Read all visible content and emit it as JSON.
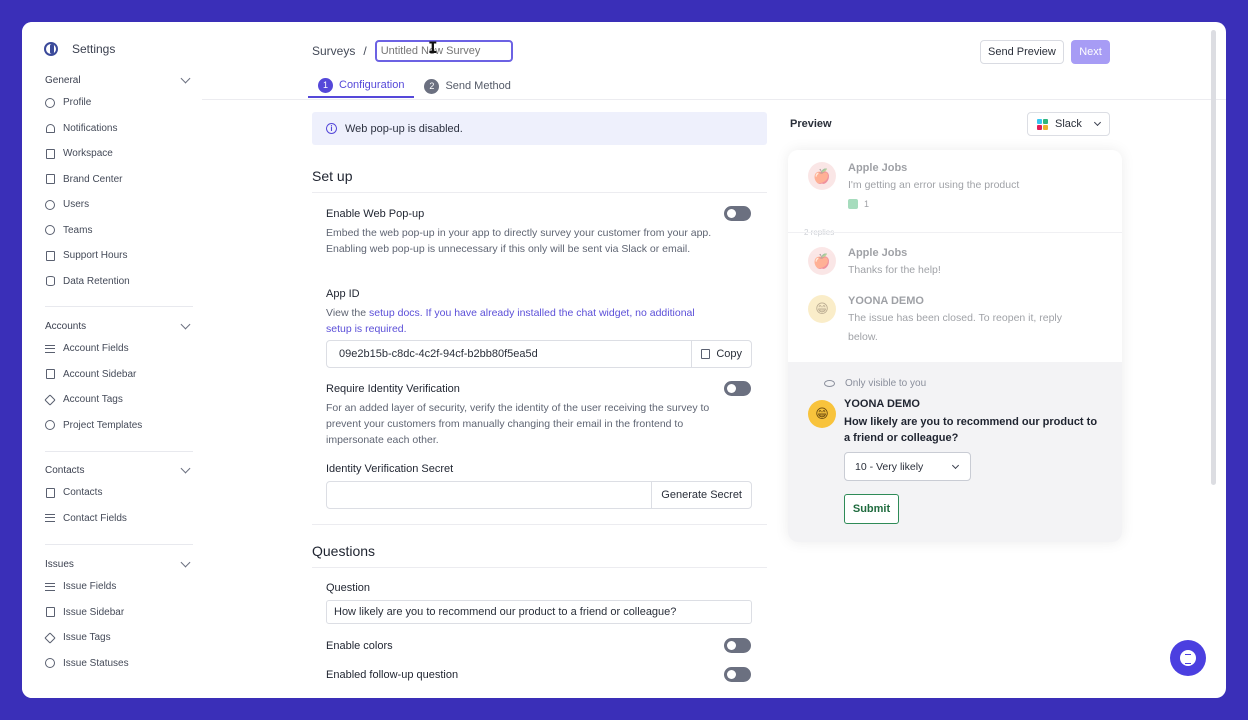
{
  "sidebar": {
    "title": "Settings",
    "sections": [
      {
        "title": "General",
        "items": [
          {
            "label": "Profile",
            "icon": "user-circle-icon"
          },
          {
            "label": "Notifications",
            "icon": "bell-icon"
          },
          {
            "label": "Workspace",
            "icon": "workspace-icon"
          },
          {
            "label": "Brand Center",
            "icon": "paint-roller-icon"
          },
          {
            "label": "Users",
            "icon": "user-icon"
          },
          {
            "label": "Teams",
            "icon": "users-icon"
          },
          {
            "label": "Support Hours",
            "icon": "calendar-clock-icon"
          },
          {
            "label": "Data Retention",
            "icon": "database-icon"
          }
        ]
      },
      {
        "title": "Accounts",
        "items": [
          {
            "label": "Account Fields",
            "icon": "list-icon"
          },
          {
            "label": "Account Sidebar",
            "icon": "sidebar-layout-icon"
          },
          {
            "label": "Account Tags",
            "icon": "tag-icon"
          },
          {
            "label": "Project Templates",
            "icon": "check-badge-icon"
          }
        ]
      },
      {
        "title": "Contacts",
        "items": [
          {
            "label": "Contacts",
            "icon": "contact-card-icon"
          },
          {
            "label": "Contact Fields",
            "icon": "list-icon"
          }
        ]
      },
      {
        "title": "Issues",
        "items": [
          {
            "label": "Issue Fields",
            "icon": "list-icon"
          },
          {
            "label": "Issue Sidebar",
            "icon": "sidebar-layout-icon"
          },
          {
            "label": "Issue Tags",
            "icon": "tag-icon"
          },
          {
            "label": "Issue Statuses",
            "icon": "status-icon"
          }
        ]
      }
    ]
  },
  "header": {
    "breadcrumb_root": "Surveys",
    "breadcrumb_sep": "/",
    "title_placeholder": "Untitled New Survey",
    "send_preview_label": "Send Preview",
    "next_label": "Next"
  },
  "tabs": [
    {
      "num": "1",
      "label": "Configuration"
    },
    {
      "num": "2",
      "label": "Send Method"
    }
  ],
  "banner": {
    "text": "Web pop-up is disabled."
  },
  "setup": {
    "heading": "Set up",
    "enable_web_popup": {
      "label": "Enable Web Pop-up",
      "desc": "Embed the web pop-up in your app to directly survey your customer from your app. Enabling web pop-up is unnecessary if this only will be sent via Slack or email."
    },
    "app_id": {
      "label": "App ID",
      "desc_prefix": "View the ",
      "desc_link": "setup docs. If you have already installed the chat widget, no additional setup is required.",
      "value": "09e2b15b-c8dc-4c2f-94cf-b2bb80f5ea5d",
      "copy_label": "Copy"
    },
    "identity_verification": {
      "label": "Require Identity Verification",
      "desc": "For an added layer of security, verify the identity of the user receiving the survey to prevent your customers from manually changing their email in the frontend to impersonate each other."
    },
    "secret": {
      "label": "Identity Verification Secret",
      "value": "",
      "generate_label": "Generate Secret"
    }
  },
  "questions": {
    "heading": "Questions",
    "question_label": "Question",
    "question_value": "How likely are you to recommend our product to a friend or colleague?",
    "enable_colors_label": "Enable colors",
    "followup_label": "Enabled follow-up question"
  },
  "preview": {
    "label": "Preview",
    "channel": "Slack",
    "messages": [
      {
        "name": "Apple Jobs",
        "text": "I'm getting an error using the product",
        "reaction_count": "1"
      },
      {
        "name": "Apple Jobs",
        "text": "Thanks for the help!"
      },
      {
        "name": "YOONA DEMO",
        "text": "The issue has been closed. To reopen it, reply below."
      }
    ],
    "replies_text": "2 replies",
    "only_visible": "Only visible to you",
    "bot_name": "YOONA DEMO",
    "survey_question": "How likely are you to recommend our product to a friend or colleague?",
    "selected_option": "10 - Very likely",
    "submit_label": "Submit"
  },
  "colors": {
    "accent": "#5548d9",
    "next_disabled": "#a79cf5",
    "background": "#3a2fb8",
    "submit_green": "#2e8b57"
  }
}
